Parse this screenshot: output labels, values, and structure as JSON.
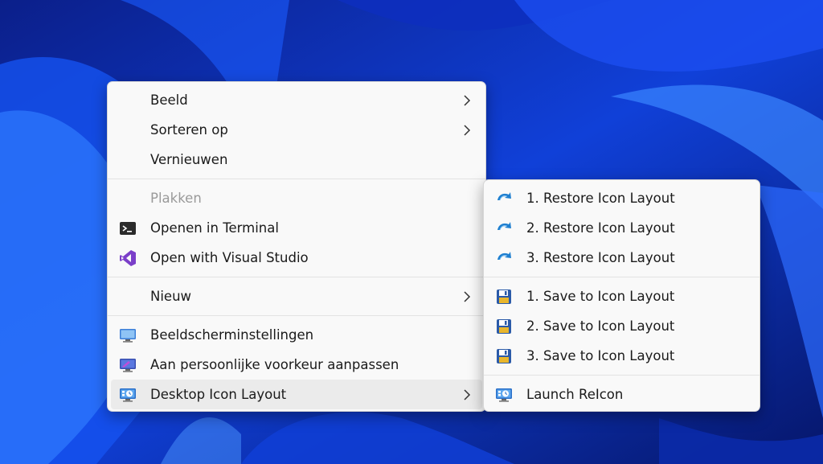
{
  "context_menu": {
    "items": [
      {
        "label": "Beeld"
      },
      {
        "label": "Sorteren op"
      },
      {
        "label": "Vernieuwen"
      },
      {
        "label": "Plakken"
      },
      {
        "label": "Openen in Terminal"
      },
      {
        "label": "Open with Visual Studio"
      },
      {
        "label": "Nieuw"
      },
      {
        "label": "Beeldscherminstellingen"
      },
      {
        "label": "Aan persoonlijke voorkeur aanpassen"
      },
      {
        "label": "Desktop Icon Layout"
      }
    ]
  },
  "submenu": {
    "items": [
      {
        "label": "1. Restore Icon Layout"
      },
      {
        "label": "2. Restore Icon Layout"
      },
      {
        "label": "3. Restore Icon Layout"
      },
      {
        "label": "1. Save to Icon Layout"
      },
      {
        "label": "2. Save to Icon Layout"
      },
      {
        "label": "3. Save to Icon Layout"
      },
      {
        "label": "Launch ReIcon"
      }
    ]
  },
  "colors": {
    "menu_background": "#f9f9f9",
    "hover_background": "#ebebeb",
    "disabled_text": "#9a9a9a",
    "wallpaper_blue": "#0a2bb0"
  }
}
